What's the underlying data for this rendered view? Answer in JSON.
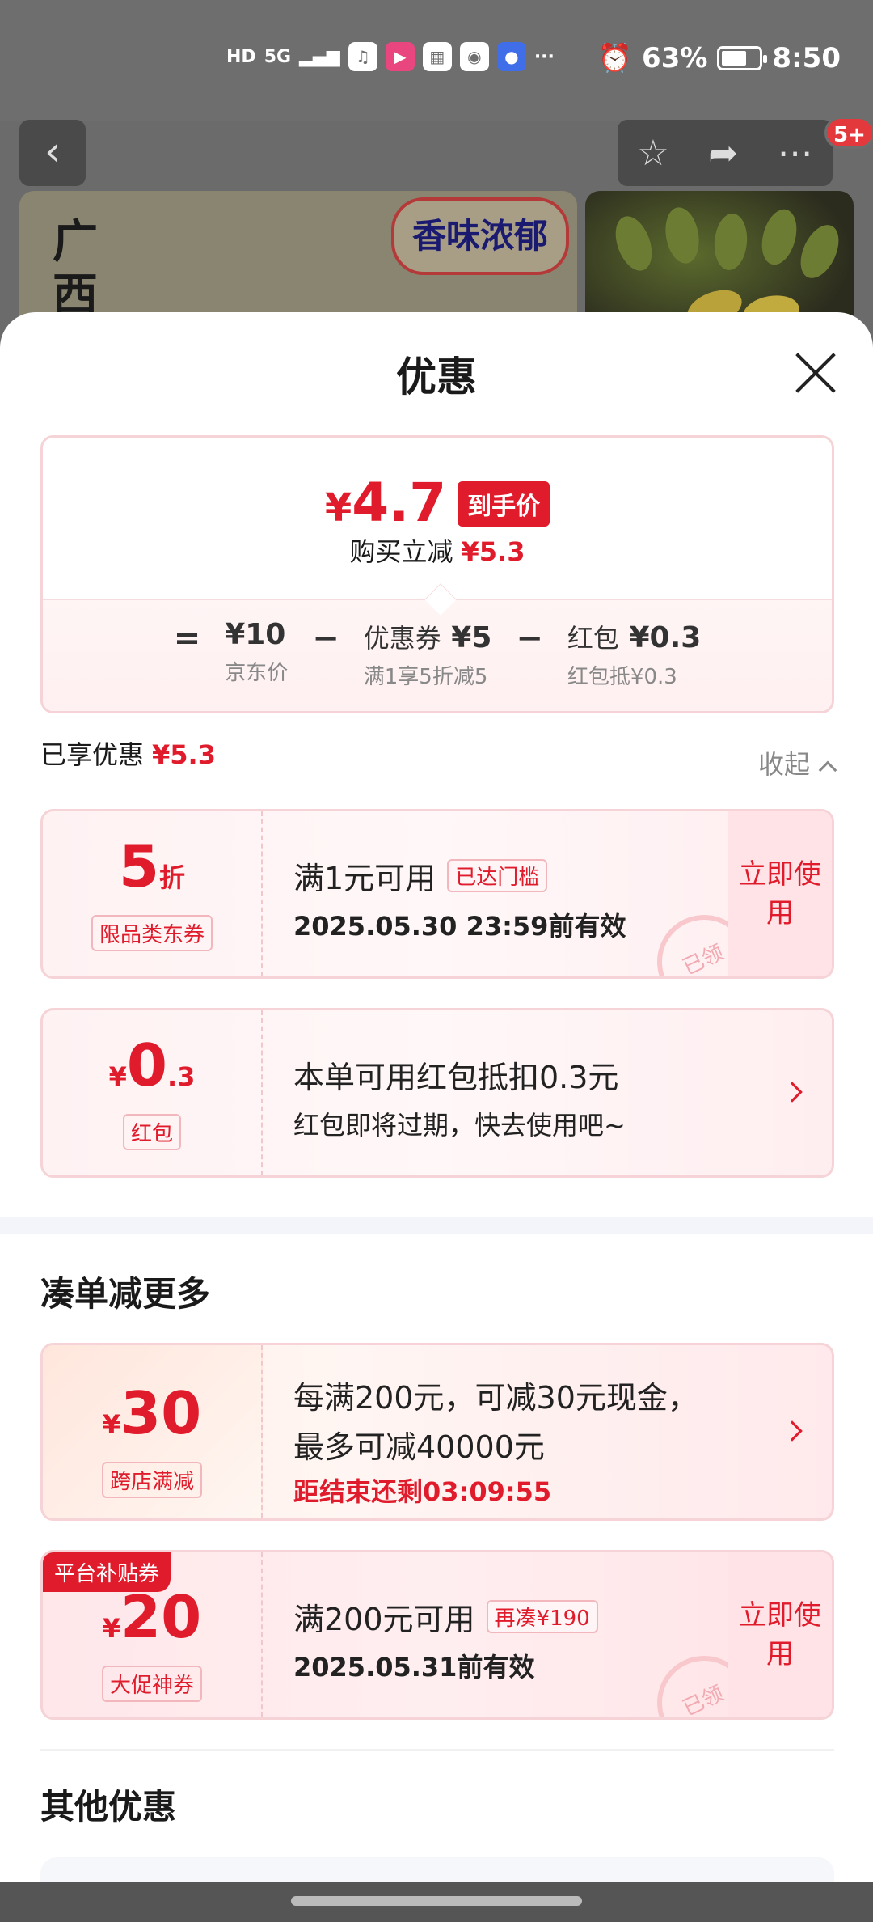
{
  "status_bar": {
    "hd": "HD",
    "net": "5G",
    "battery": "63%",
    "time": "8:50",
    "dots": "···"
  },
  "header": {
    "badge": "5+",
    "banner_vertical": "广西",
    "banner_tag": "香味浓郁"
  },
  "sheet": {
    "title": "优惠",
    "price": {
      "currency": "¥",
      "final": "4.7",
      "final_tag": "到手价",
      "reduce_label": "购买立减",
      "reduce_value": "¥5.3",
      "formula": {
        "eq": "=",
        "minus": "−",
        "jd_price": "¥10",
        "jd_price_label": "京东价",
        "coupon_label": "优惠券",
        "coupon_value": "¥5",
        "coupon_note": "满1享5折减5",
        "hongbao_label": "红包",
        "hongbao_value": "¥0.3",
        "hongbao_note": "红包抵¥0.3"
      }
    },
    "enjoyed_label": "已享优惠",
    "enjoyed_value": "¥5.3",
    "collapse_label": "收起",
    "coupons": [
      {
        "amount": "5",
        "unit": "折",
        "label": "限品类东券",
        "title": "满1元可用",
        "tag": "已达门槛",
        "sub": "2025.05.30 23:59前有效",
        "action": "立即使用",
        "stamp": "已领"
      },
      {
        "currency": "¥",
        "amount": "0",
        "amount_dec": ".3",
        "label": "红包",
        "title": "本单可用红包抵扣0.3元",
        "sub": "红包即将过期，快去使用吧~"
      }
    ],
    "more_section_title": "凑单减更多",
    "more_coupons": [
      {
        "currency": "¥",
        "amount": "30",
        "label": "跨店满减",
        "title": "每满200元，可减30元现金，",
        "title2": "最多可减40000元",
        "countdown": "距结束还剩03:09:55"
      },
      {
        "corner": "平台补贴券",
        "currency": "¥",
        "amount": "20",
        "label": "大促神券",
        "title": "满200元可用",
        "tag": "再凑¥190",
        "sub": "2025.05.31前有效",
        "action": "立即使用",
        "stamp": "已领"
      }
    ],
    "other_section_title": "其他优惠"
  },
  "colors": {
    "accent_red": "#e01c2c",
    "coupon_border": "#f5d3d6",
    "scrim": "#6b6b6b"
  }
}
